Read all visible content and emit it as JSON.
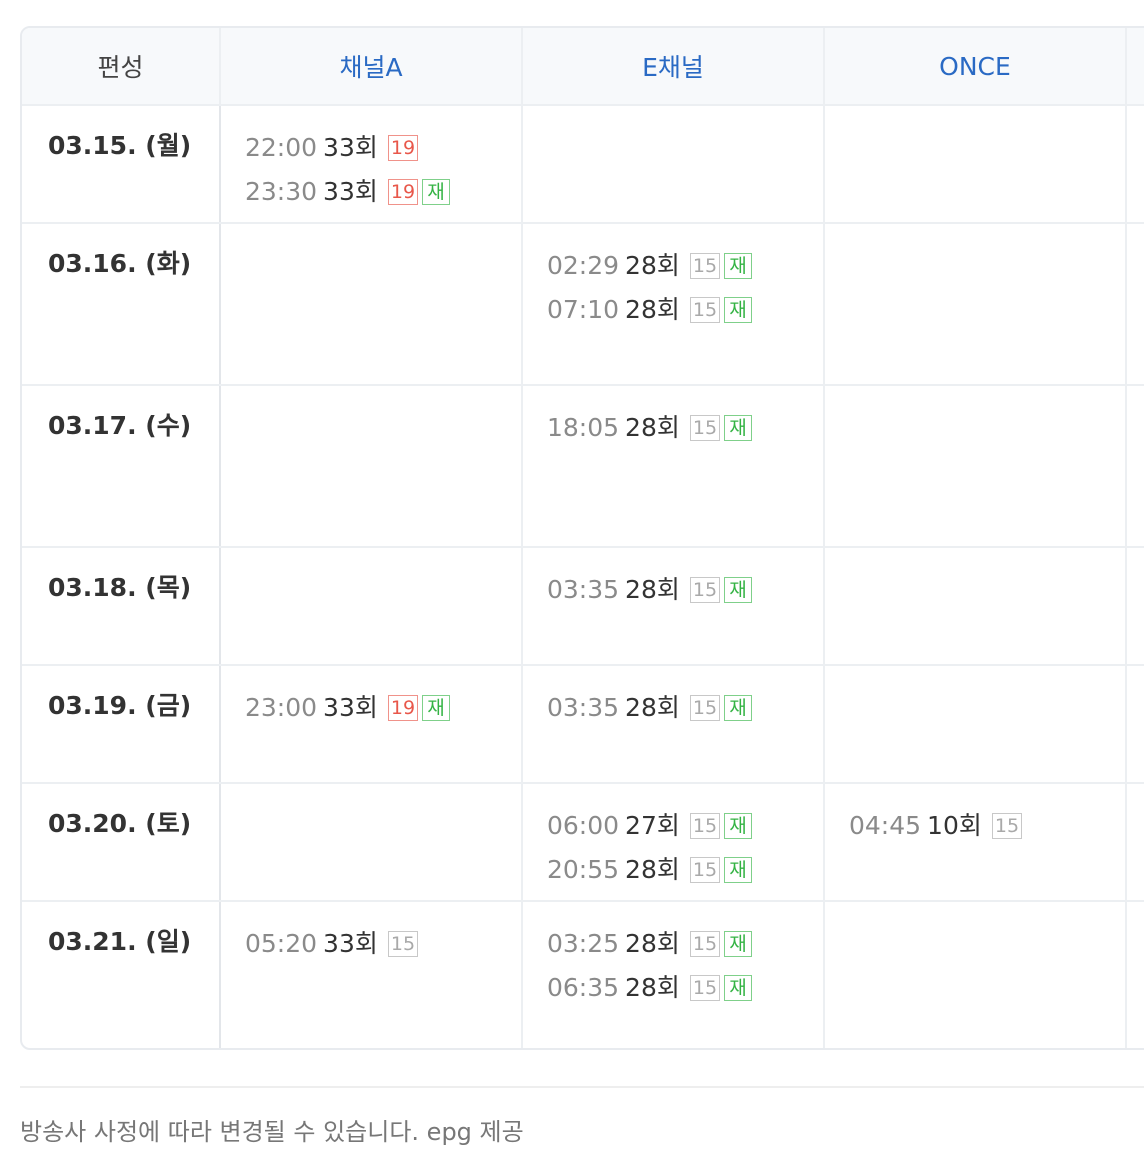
{
  "header": {
    "date_col": "편성",
    "channels": [
      "채널A",
      "E채널",
      "ONCE"
    ]
  },
  "rows": [
    {
      "date": "03.15. (월)",
      "cells": [
        [
          {
            "time": "22:00",
            "ep": "33회",
            "rating": "19",
            "rerun": false
          },
          {
            "time": "23:30",
            "ep": "33회",
            "rating": "19",
            "rerun": true
          }
        ],
        [],
        []
      ]
    },
    {
      "date": "03.16. (화)",
      "cells": [
        [],
        [
          {
            "time": "02:29",
            "ep": "28회",
            "rating": "15",
            "rerun": true
          },
          {
            "time": "07:10",
            "ep": "28회",
            "rating": "15",
            "rerun": true
          }
        ],
        []
      ]
    },
    {
      "date": "03.17. (수)",
      "cells": [
        [],
        [
          {
            "time": "18:05",
            "ep": "28회",
            "rating": "15",
            "rerun": true
          }
        ],
        []
      ]
    },
    {
      "date": "03.18. (목)",
      "cells": [
        [],
        [
          {
            "time": "03:35",
            "ep": "28회",
            "rating": "15",
            "rerun": true
          }
        ],
        []
      ]
    },
    {
      "date": "03.19. (금)",
      "cells": [
        [
          {
            "time": "23:00",
            "ep": "33회",
            "rating": "19",
            "rerun": true
          }
        ],
        [
          {
            "time": "03:35",
            "ep": "28회",
            "rating": "15",
            "rerun": true
          }
        ],
        []
      ]
    },
    {
      "date": "03.20. (토)",
      "cells": [
        [],
        [
          {
            "time": "06:00",
            "ep": "27회",
            "rating": "15",
            "rerun": true
          },
          {
            "time": "20:55",
            "ep": "28회",
            "rating": "15",
            "rerun": true
          }
        ],
        [
          {
            "time": "04:45",
            "ep": "10회",
            "rating": "15",
            "rerun": false
          }
        ]
      ]
    },
    {
      "date": "03.21. (일)",
      "cells": [
        [
          {
            "time": "05:20",
            "ep": "33회",
            "rating": "15",
            "rerun": false
          }
        ],
        [
          {
            "time": "03:25",
            "ep": "28회",
            "rating": "15",
            "rerun": true
          },
          {
            "time": "06:35",
            "ep": "28회",
            "rating": "15",
            "rerun": true
          }
        ],
        []
      ]
    }
  ],
  "rerun_label": "재",
  "footer": "방송사 사정에 따라 변경될 수 있습니다. epg 제공",
  "colors": {
    "channel_header": "#2a6ac4",
    "rating19": "#e8574a",
    "rerun": "#34b344",
    "rating15": "#a9a9a9"
  }
}
